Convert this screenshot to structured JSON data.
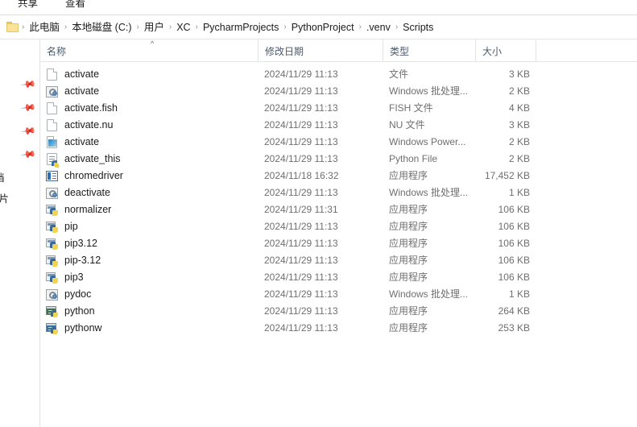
{
  "ribbon": {
    "tabs": [
      {
        "label": "共享",
        "name": "ribbon-tab-share"
      },
      {
        "label": "查看",
        "name": "ribbon-tab-view"
      }
    ]
  },
  "addressbar": {
    "folder_icon": "folder-icon",
    "separator": "›",
    "crumbs": [
      "此电脑",
      "本地磁盘 (C:)",
      "用户",
      "XC",
      "PycharmProjects",
      "PythonProject",
      ".venv",
      "Scripts"
    ]
  },
  "navpane": {
    "pin_icon": "pin-icon",
    "pins": [
      "pin",
      "pin",
      "pin",
      "pin"
    ],
    "clipped_labels": [
      "档",
      "图片"
    ]
  },
  "columns": {
    "sort_caret": "^",
    "headers": [
      {
        "label": "名称",
        "key": "name"
      },
      {
        "label": "修改日期",
        "key": "date"
      },
      {
        "label": "类型",
        "key": "type"
      },
      {
        "label": "大小",
        "key": "size"
      }
    ]
  },
  "files": [
    {
      "name": "activate",
      "date": "2024/11/29 11:13",
      "type": "文件",
      "size": "3 KB",
      "icon": "doc"
    },
    {
      "name": "activate",
      "date": "2024/11/29 11:13",
      "type": "Windows 批处理...",
      "size": "2 KB",
      "icon": "bat"
    },
    {
      "name": "activate.fish",
      "date": "2024/11/29 11:13",
      "type": "FISH 文件",
      "size": "4 KB",
      "icon": "doc"
    },
    {
      "name": "activate.nu",
      "date": "2024/11/29 11:13",
      "type": "NU 文件",
      "size": "3 KB",
      "icon": "doc"
    },
    {
      "name": "activate",
      "date": "2024/11/29 11:13",
      "type": "Windows Power...",
      "size": "2 KB",
      "icon": "ps1"
    },
    {
      "name": "activate_this",
      "date": "2024/11/29 11:13",
      "type": "Python File",
      "size": "2 KB",
      "icon": "py"
    },
    {
      "name": "chromedriver",
      "date": "2024/11/18 16:32",
      "type": "应用程序",
      "size": "17,452 KB",
      "icon": "app"
    },
    {
      "name": "deactivate",
      "date": "2024/11/29 11:13",
      "type": "Windows 批处理...",
      "size": "1 KB",
      "icon": "bat"
    },
    {
      "name": "normalizer",
      "date": "2024/11/29 11:31",
      "type": "应用程序",
      "size": "106 KB",
      "icon": "pyexe"
    },
    {
      "name": "pip",
      "date": "2024/11/29 11:13",
      "type": "应用程序",
      "size": "106 KB",
      "icon": "pyexe"
    },
    {
      "name": "pip3.12",
      "date": "2024/11/29 11:13",
      "type": "应用程序",
      "size": "106 KB",
      "icon": "pyexe"
    },
    {
      "name": "pip-3.12",
      "date": "2024/11/29 11:13",
      "type": "应用程序",
      "size": "106 KB",
      "icon": "pyexe"
    },
    {
      "name": "pip3",
      "date": "2024/11/29 11:13",
      "type": "应用程序",
      "size": "106 KB",
      "icon": "pyexe"
    },
    {
      "name": "pydoc",
      "date": "2024/11/29 11:13",
      "type": "Windows 批处理...",
      "size": "1 KB",
      "icon": "bat"
    },
    {
      "name": "python",
      "date": "2024/11/29 11:13",
      "type": "应用程序",
      "size": "264 KB",
      "icon": "pyterm"
    },
    {
      "name": "pythonw",
      "date": "2024/11/29 11:13",
      "type": "应用程序",
      "size": "253 KB",
      "icon": "pytermw"
    }
  ],
  "colors": {
    "header_text": "#4a5b6b",
    "secondary_text": "#6f6f6f",
    "primary_text": "#1b1b1b",
    "divider": "#e4e4e4",
    "folder_yellow": "#fbe39a"
  }
}
